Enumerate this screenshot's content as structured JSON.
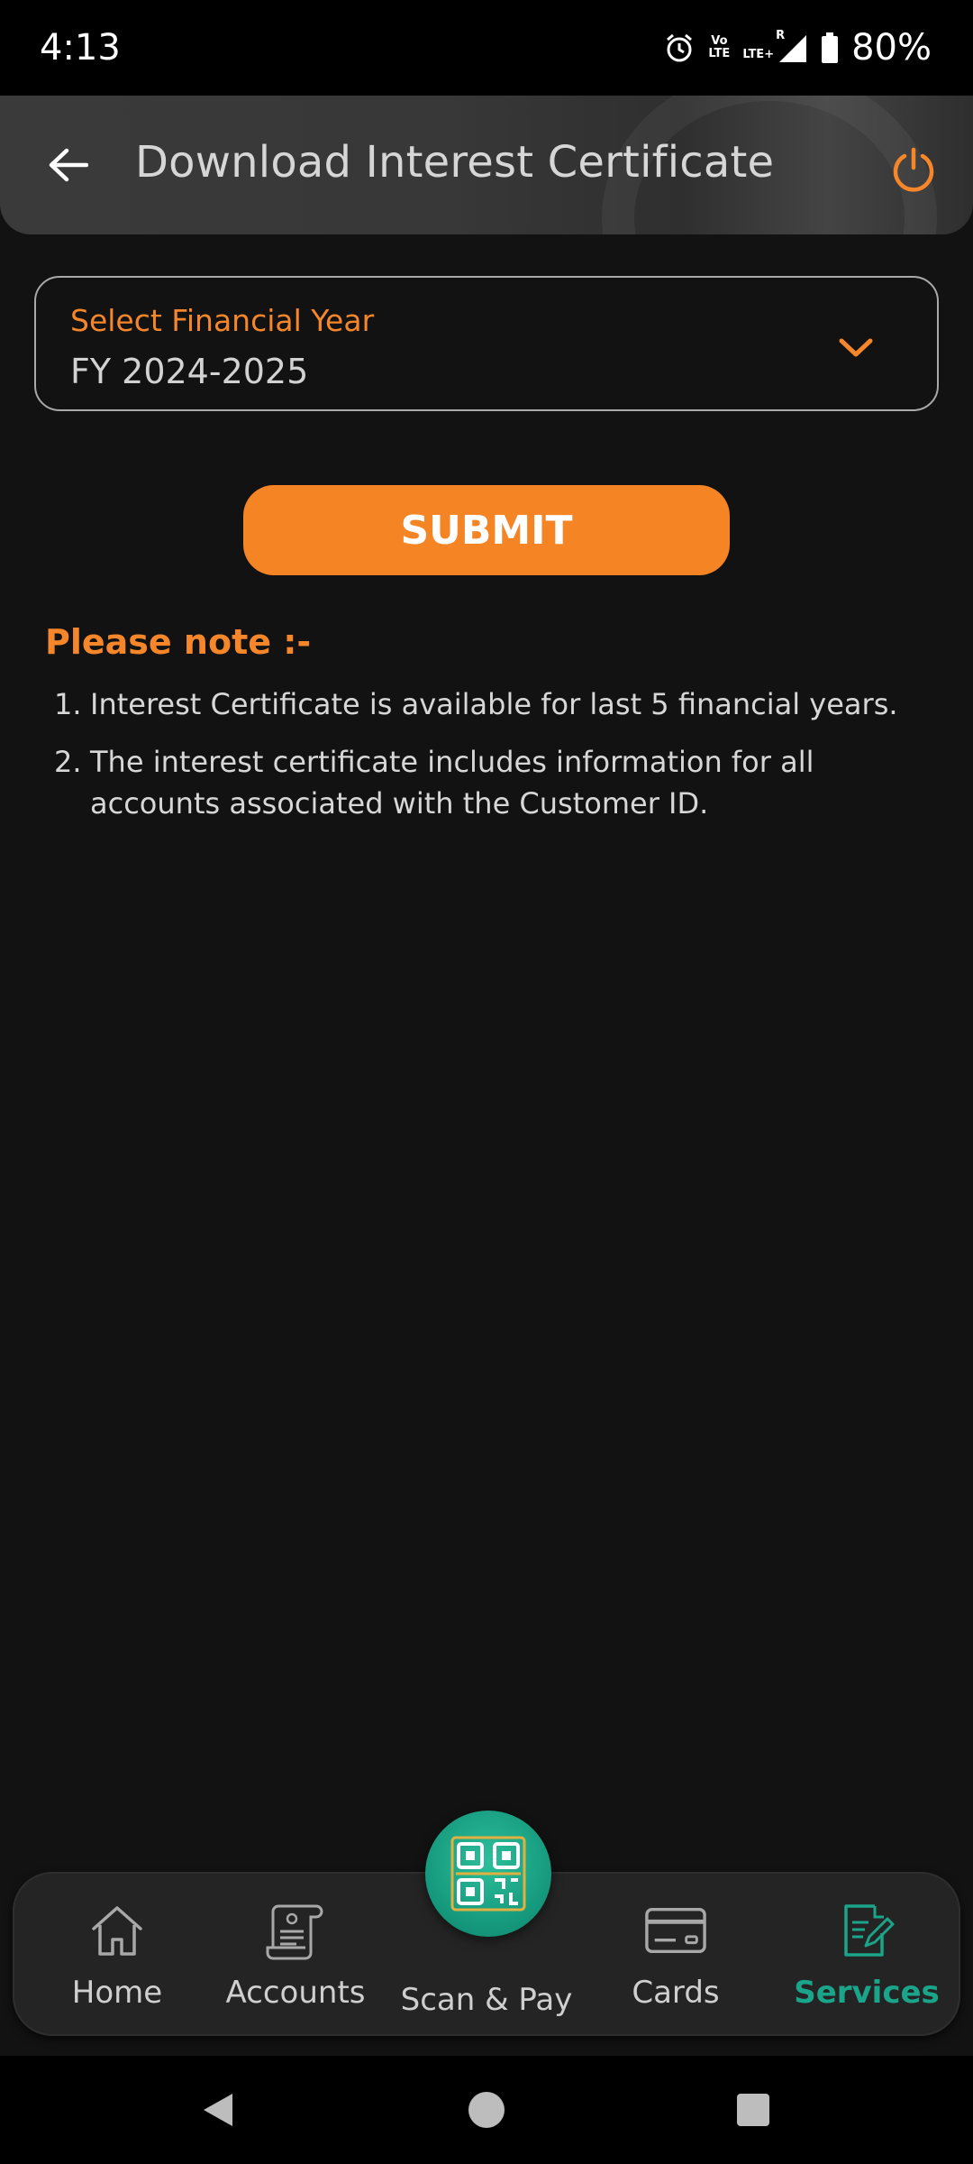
{
  "status_bar": {
    "time": "4:13",
    "volte_top": "Vo",
    "volte_bottom": "LTE",
    "lte_plus": "LTE+",
    "roaming": "R",
    "battery": "80%",
    "icons": [
      "alarm-icon",
      "volte-icon",
      "signal-icon",
      "battery-icon"
    ]
  },
  "app_bar": {
    "title": "Download Interest Certificate",
    "back_icon": "arrow-left-icon",
    "power_icon": "power-icon"
  },
  "year_select": {
    "label": "Select Financial Year",
    "value": "FY 2024-2025",
    "icon": "chevron-down-icon"
  },
  "submit": {
    "label": "SUBMIT"
  },
  "note": {
    "title": "Please note :-",
    "items": [
      {
        "num": "1.",
        "text": "Interest Certificate is available for last 5 financial years."
      },
      {
        "num": "2.",
        "text": "The interest certificate includes information for all accounts associated with the Customer ID."
      }
    ]
  },
  "bottom_nav": {
    "items": [
      {
        "label": "Home",
        "icon": "home-icon"
      },
      {
        "label": "Accounts",
        "icon": "accounts-icon"
      },
      {
        "label": "Scan & Pay",
        "icon": "qr-code-icon"
      },
      {
        "label": "Cards",
        "icon": "card-icon"
      },
      {
        "label": "Services",
        "icon": "services-icon"
      }
    ],
    "active_color": "#1aa58a"
  },
  "colors": {
    "accent": "#f58424",
    "background": "#121212",
    "active_nav": "#1aa58a"
  }
}
